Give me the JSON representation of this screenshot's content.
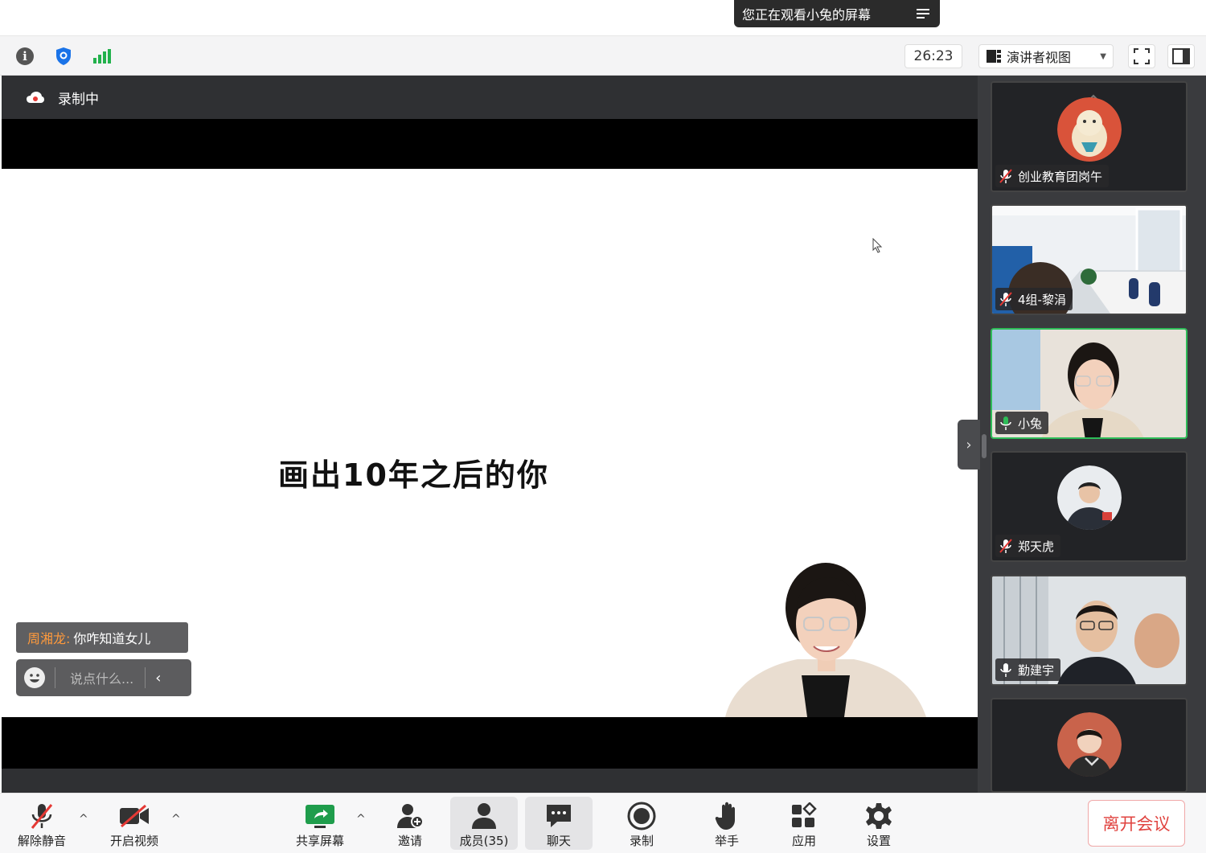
{
  "banner": {
    "text": "您正在观看小兔的屏幕"
  },
  "topbar": {
    "timer": "26:23",
    "view_label": "演讲者视图"
  },
  "stage": {
    "recording_label": "录制中",
    "slide_title": "画出10年之后的你"
  },
  "chat": {
    "sender": "周湘龙:",
    "message": "你咋知道女儿",
    "input_placeholder": "说点什么..."
  },
  "participants": [
    {
      "name": "创业教育团岗午",
      "muted": true,
      "type": "avatar"
    },
    {
      "name": "4组-黎涓",
      "muted": true,
      "type": "video"
    },
    {
      "name": "小兔",
      "muted": false,
      "speaking": true,
      "type": "video"
    },
    {
      "name": "郑天虎",
      "muted": true,
      "type": "avatar"
    },
    {
      "name": "勤建宇",
      "muted": false,
      "type": "video"
    },
    {
      "name": "",
      "muted": true,
      "type": "avatar"
    }
  ],
  "toolbar": {
    "unmute": "解除静音",
    "start_video": "开启视频",
    "share_screen": "共享屏幕",
    "invite": "邀请",
    "members": "成员(35)",
    "chat": "聊天",
    "record": "录制",
    "raise_hand": "举手",
    "apps": "应用",
    "settings": "设置",
    "leave": "离开会议"
  },
  "colors": {
    "active_border": "#2ebc58",
    "leave_text": "#e0433f",
    "sender": "#ff9a3c",
    "shield": "#1a73e8",
    "signal": "#22b14c"
  }
}
